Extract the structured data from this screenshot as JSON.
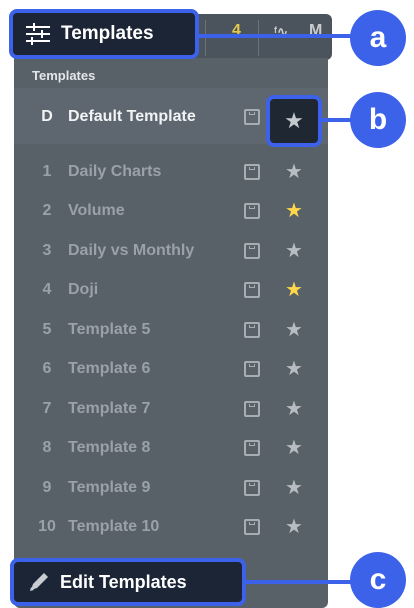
{
  "toolbar": {
    "templates_button_label": "Templates",
    "extra_items": [
      "4",
      "M"
    ]
  },
  "dropdown": {
    "section_label": "Templates",
    "default_template": {
      "key": "D",
      "name": "Default Template",
      "favorite": false
    },
    "templates": [
      {
        "num": "1",
        "name": "Daily Charts",
        "favorite": false
      },
      {
        "num": "2",
        "name": "Volume",
        "favorite": true
      },
      {
        "num": "3",
        "name": "Daily vs Monthly",
        "favorite": false
      },
      {
        "num": "4",
        "name": "Doji",
        "favorite": true
      },
      {
        "num": "5",
        "name": "Template 5",
        "favorite": false
      },
      {
        "num": "6",
        "name": "Template 6",
        "favorite": false
      },
      {
        "num": "7",
        "name": "Template 7",
        "favorite": false
      },
      {
        "num": "8",
        "name": "Template 8",
        "favorite": false
      },
      {
        "num": "9",
        "name": "Template 9",
        "favorite": false
      },
      {
        "num": "10",
        "name": "Template 10",
        "favorite": false
      }
    ],
    "edit_button_label": "Edit Templates"
  },
  "annotations": {
    "a": "a",
    "b": "b",
    "c": "c"
  },
  "colors": {
    "accent": "#3d62ea",
    "panel": "#586068",
    "favorite_star": "#ffd84a",
    "button_bg": "#1b2536"
  },
  "icons": [
    "sliders-icon",
    "save-icon",
    "star-icon",
    "pencil-icon"
  ]
}
